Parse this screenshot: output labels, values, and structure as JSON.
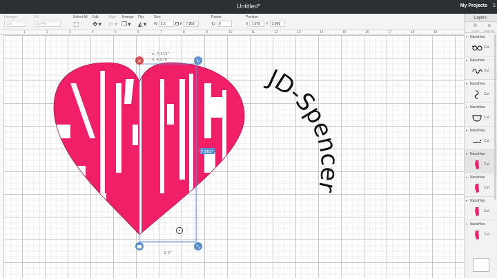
{
  "window": {
    "title": "Untitled*",
    "my_projects": "My Projects",
    "more": "S"
  },
  "toolbar": {
    "linetype": {
      "label": "Linetype",
      "value": "Cut"
    },
    "fill": {
      "label": "Fill",
      "value": "No Fill"
    },
    "select_all": {
      "label": "Select All"
    },
    "edit": {
      "label": "Edit"
    },
    "align": {
      "label": "Align"
    },
    "arrange": {
      "label": "Arrange"
    },
    "flip": {
      "label": "Flip"
    },
    "size": {
      "label": "Size",
      "w_label": "W",
      "w_value": "2.2",
      "h_label": "H",
      "h_value": "7.862"
    },
    "rotate": {
      "label": "Rotate",
      "value": "0"
    },
    "position": {
      "label": "Position",
      "x_label": "X",
      "x_value": "7.579",
      "y_label": "Y",
      "y_value": "3.969"
    }
  },
  "ruler": {
    "marks": [
      "1",
      "2",
      "3",
      "4",
      "5",
      "6",
      "7",
      "8",
      "9",
      "10",
      "11",
      "12",
      "13",
      "14",
      "15",
      "16",
      "17",
      "18",
      "19"
    ]
  },
  "layers_panel": {
    "tab_label": "Layers",
    "actions": [
      "Group",
      "Ungroup"
    ],
    "groups": [
      {
        "name": "NanaHea",
        "op": "Cut",
        "thumb": "glasses",
        "selected": false
      },
      {
        "name": "NanaHea",
        "op": "Cut",
        "thumb": "curl",
        "selected": false
      },
      {
        "name": "NanaHea",
        "op": "Cut",
        "thumb": "hook",
        "selected": false
      },
      {
        "name": "NanaHea",
        "op": "Cut",
        "thumb": "bowl",
        "selected": false
      },
      {
        "name": "NanaHea",
        "op": "Cut",
        "thumb": "squiggle",
        "selected": false
      },
      {
        "name": "NanaHea",
        "op": "Cut",
        "thumb": "pink-piece",
        "selected": true
      },
      {
        "name": "NanaHea",
        "op": "Cut",
        "thumb": "pink-piece",
        "selected": false
      },
      {
        "name": "NanaHea",
        "op": "Cut",
        "thumb": "pink-piece",
        "selected": false
      },
      {
        "name": "NanaHea",
        "op": "Cut",
        "thumb": "pink-piece",
        "selected": false
      }
    ]
  },
  "selection": {
    "xy_readout_x": "x: 7.315\"",
    "xy_readout_y": "y: 4.076\"",
    "height_readout": "7.862\"",
    "width_readout": "2.2\""
  },
  "design": {
    "pink": "#f01f68",
    "main_text": "Nana",
    "curved_text": "JD-Spencer"
  },
  "colors": {
    "accent_blue": "#5b8fd0",
    "delete_red": "#d94a4a",
    "toolbar_bg": "#f4f4f4",
    "titlebar_bg": "#2d3033"
  }
}
